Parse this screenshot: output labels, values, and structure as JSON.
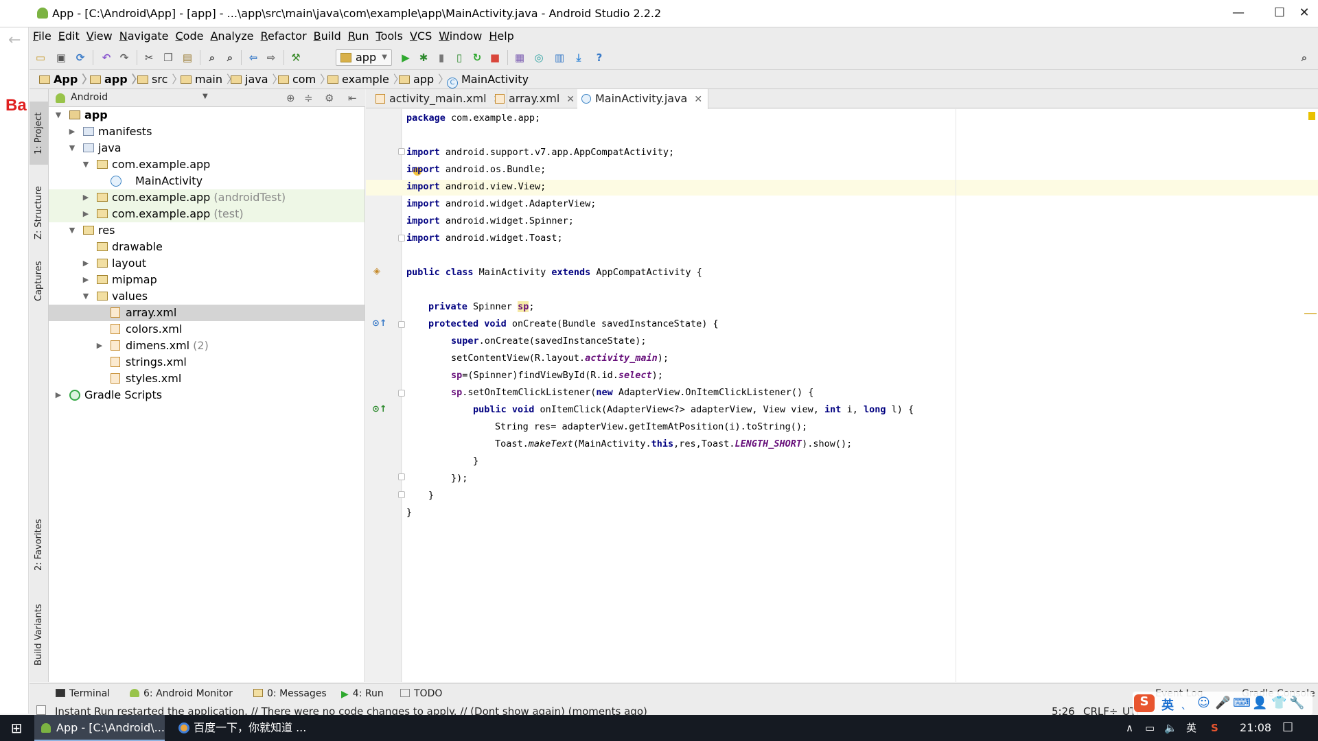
{
  "window": {
    "title": "App - [C:\\Android\\App] - [app] - ...\\app\\src\\main\\java\\com\\example\\app\\MainActivity.java - Android Studio 2.2.2",
    "minimize": "—",
    "maximize": "☐",
    "close": "✕"
  },
  "behind": {
    "back_arrow": "←",
    "fragment": "Ba"
  },
  "menu": [
    "File",
    "Edit",
    "View",
    "Navigate",
    "Code",
    "Analyze",
    "Refactor",
    "Build",
    "Run",
    "Tools",
    "VCS",
    "Window",
    "Help"
  ],
  "toolbar": {
    "run_config": "app",
    "icons": [
      "open-folder-icon",
      "save-icon",
      "sync-icon",
      "undo-icon",
      "redo-icon",
      "cut-icon",
      "copy-icon",
      "paste-icon",
      "find-icon",
      "replace-icon",
      "back-icon",
      "forward-icon",
      "make-icon",
      "run-icon",
      "debug-icon",
      "profile-icon",
      "attach-icon",
      "apply-changes-icon",
      "stop-icon",
      "avd-icon",
      "gradle-sync-icon",
      "project-structure-icon",
      "sdk-download-icon",
      "help-icon",
      "search-icon"
    ]
  },
  "breadcrumb": [
    "App",
    "app",
    "src",
    "main",
    "java",
    "com",
    "example",
    "app",
    "MainActivity"
  ],
  "left_tool_tabs": [
    "1: Project",
    "Z: Structure",
    "Captures",
    "2: Favorites",
    "Build Variants"
  ],
  "project_panel": {
    "view": "Android",
    "tree": [
      {
        "label": "app",
        "hint": "",
        "depth": 0,
        "toggle": "▼",
        "icon": "module"
      },
      {
        "label": "manifests",
        "hint": "",
        "depth": 1,
        "toggle": "▶",
        "icon": "folder"
      },
      {
        "label": "java",
        "hint": "",
        "depth": 1,
        "toggle": "▼",
        "icon": "folder"
      },
      {
        "label": "com.example.app",
        "hint": "",
        "depth": 2,
        "toggle": "▼",
        "icon": "package"
      },
      {
        "label": "MainActivity",
        "hint": "",
        "depth": 3,
        "toggle": "",
        "icon": "class"
      },
      {
        "label": "com.example.app",
        "hint": " (androidTest)",
        "depth": 2,
        "toggle": "▶",
        "icon": "package"
      },
      {
        "label": "com.example.app",
        "hint": " (test)",
        "depth": 2,
        "toggle": "▶",
        "icon": "package"
      },
      {
        "label": "res",
        "hint": "",
        "depth": 1,
        "toggle": "▼",
        "icon": "resfolder"
      },
      {
        "label": "drawable",
        "hint": "",
        "depth": 2,
        "toggle": "",
        "icon": "resfolder"
      },
      {
        "label": "layout",
        "hint": "",
        "depth": 2,
        "toggle": "▶",
        "icon": "resfolder"
      },
      {
        "label": "mipmap",
        "hint": "",
        "depth": 2,
        "toggle": "▶",
        "icon": "resfolder"
      },
      {
        "label": "values",
        "hint": "",
        "depth": 2,
        "toggle": "▼",
        "icon": "resfolder"
      },
      {
        "label": "array.xml",
        "hint": "",
        "depth": 3,
        "toggle": "",
        "icon": "xml"
      },
      {
        "label": "colors.xml",
        "hint": "",
        "depth": 3,
        "toggle": "",
        "icon": "xml"
      },
      {
        "label": "dimens.xml",
        "hint": " (2)",
        "depth": 3,
        "toggle": "▶",
        "icon": "xml"
      },
      {
        "label": "strings.xml",
        "hint": "",
        "depth": 3,
        "toggle": "",
        "icon": "xml"
      },
      {
        "label": "styles.xml",
        "hint": "",
        "depth": 3,
        "toggle": "",
        "icon": "xml"
      },
      {
        "label": "Gradle Scripts",
        "hint": "",
        "depth": 0,
        "toggle": "▶",
        "icon": "gradle"
      }
    ],
    "selected": "array.xml"
  },
  "editor_tabs": [
    {
      "label": "activity_main.xml",
      "icon": "xml",
      "active": false
    },
    {
      "label": "array.xml",
      "icon": "xml",
      "active": false
    },
    {
      "label": "MainActivity.java",
      "icon": "class",
      "active": true
    }
  ],
  "code": {
    "l1": [
      "package",
      " com.example.app;"
    ],
    "l3": [
      "import",
      " android.support.v7.app.AppCompatActivity;"
    ],
    "l4": [
      "import",
      " android.os.Bundle;"
    ],
    "l5": [
      "import",
      " android.view.View;"
    ],
    "l6": [
      "import",
      " android.widget.AdapterView;"
    ],
    "l7": [
      "import",
      " android.widget.Spinner;"
    ],
    "l8": [
      "import",
      " android.widget.Toast;"
    ],
    "l10": [
      "public class",
      " MainActivity ",
      "extends",
      " AppCompatActivity {"
    ],
    "l12": [
      "private",
      " Spinner ",
      "sp",
      ";"
    ],
    "l13": [
      "protected void",
      " onCreate(Bundle savedInstanceState) {"
    ],
    "l14": [
      "super",
      ".onCreate(savedInstanceState);"
    ],
    "l15": [
      "setContentView(R.layout.",
      "activity_main",
      ");"
    ],
    "l16": [
      "sp",
      "=(Spinner)findViewById(R.id.",
      "select",
      ");"
    ],
    "l17": [
      "sp",
      ".setOnItemClickListener(",
      "new",
      " AdapterView.OnItemClickListener() {"
    ],
    "l18": [
      "public void",
      " onItemClick(AdapterView<?> adapterView, View view, ",
      "int",
      " i, ",
      "long",
      " l) {"
    ],
    "l19": [
      "String res= adapterView.getItemAtPosition(i).toString();"
    ],
    "l20": [
      "Toast.",
      "makeText",
      "(MainActivity.",
      "this",
      ",res,Toast.",
      "LENGTH_SHORT",
      ").show();"
    ],
    "l21": [
      "}"
    ],
    "l22": [
      "});"
    ],
    "l23": [
      "}"
    ],
    "l24": [
      "}"
    ]
  },
  "bottom_tabs": [
    {
      "label": "Terminal",
      "icon": "terminal-icon"
    },
    {
      "label": "6: Android Monitor",
      "icon": "android-icon"
    },
    {
      "label": "0: Messages",
      "icon": "messages-icon"
    },
    {
      "label": "4: Run",
      "icon": "run-icon"
    },
    {
      "label": "TODO",
      "icon": "todo-icon"
    }
  ],
  "bottom_right_tabs": [
    "Event Log",
    "Gradle Console"
  ],
  "status": {
    "message": "Instant Run restarted the application. // There were no code changes to apply. // (Dont show again) (moments ago)",
    "position": "5:26",
    "line_sep": "CRLF÷",
    "encoding": "UTF"
  },
  "ime": [
    "S",
    "英",
    "ˎ",
    "☺",
    "🎤",
    "⌨",
    "👤",
    "👕",
    "🔧"
  ],
  "taskbar": {
    "start": "⊞",
    "tasks": [
      {
        "label": "App - [C:\\Android\\...",
        "active": true
      },
      {
        "label": "百度一下，你就知道 ...",
        "active": false
      }
    ],
    "tray": [
      "∧",
      "▭",
      "🔈",
      "英",
      "S"
    ],
    "time": "21:08",
    "notification": "☐"
  },
  "colors": {
    "keyword": "#000080",
    "field": "#660e7a",
    "current_line": "#fdfbe3",
    "selection": "#d4d4d4",
    "test_package_bg": "#eef7e6"
  }
}
